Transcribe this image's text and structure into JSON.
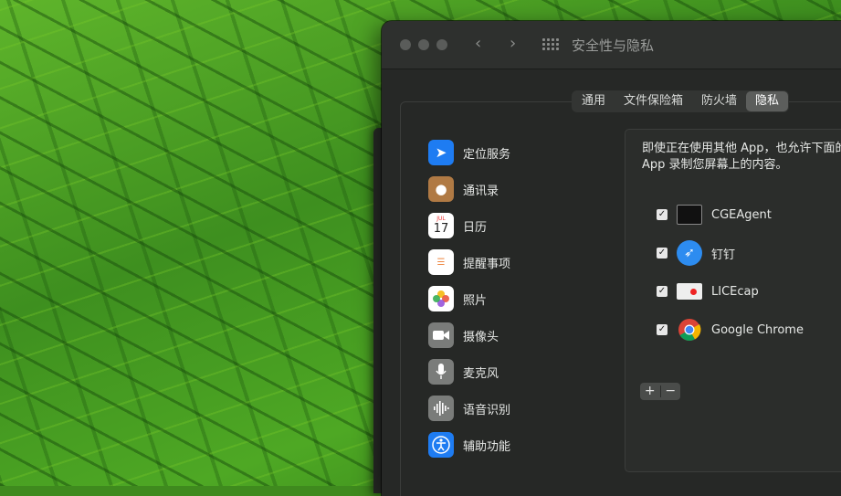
{
  "window": {
    "title": "安全性与隐私"
  },
  "tabs": [
    "通用",
    "文件保险箱",
    "防火墙",
    "隐私"
  ],
  "active_tab": "隐私",
  "sidebar": {
    "items": [
      {
        "label": "定位服务",
        "icon": "location-arrow-icon",
        "color": "#1e7cf2"
      },
      {
        "label": "通讯录",
        "icon": "contacts-book-icon",
        "color": "#b07a44"
      },
      {
        "label": "日历",
        "icon": "calendar-icon",
        "color": "#ffffff",
        "month": "JUL",
        "day": "17"
      },
      {
        "label": "提醒事项",
        "icon": "reminders-icon",
        "color": "#ffffff"
      },
      {
        "label": "照片",
        "icon": "photos-icon",
        "color": "#ffffff"
      },
      {
        "label": "摄像头",
        "icon": "camera-icon",
        "color": "#7a7c7a"
      },
      {
        "label": "麦克风",
        "icon": "microphone-icon",
        "color": "#7a7c7a"
      },
      {
        "label": "语音识别",
        "icon": "waveform-icon",
        "color": "#7a7c7a"
      },
      {
        "label": "辅助功能",
        "icon": "accessibility-icon",
        "color": "#1e7cf2"
      }
    ]
  },
  "detail": {
    "description": "即使正在使用其他 App，也允许下面的 App 录制您屏幕上的内容。",
    "apps": [
      {
        "name": "CGEAgent",
        "checked": true,
        "icon": "terminal-icon"
      },
      {
        "name": "钉钉",
        "checked": true,
        "icon": "dingtalk-icon"
      },
      {
        "name": "LICEcap",
        "checked": true,
        "icon": "licecap-icon"
      },
      {
        "name": "Google Chrome",
        "checked": true,
        "icon": "chrome-icon"
      }
    ],
    "add_label": "+",
    "remove_label": "−"
  }
}
